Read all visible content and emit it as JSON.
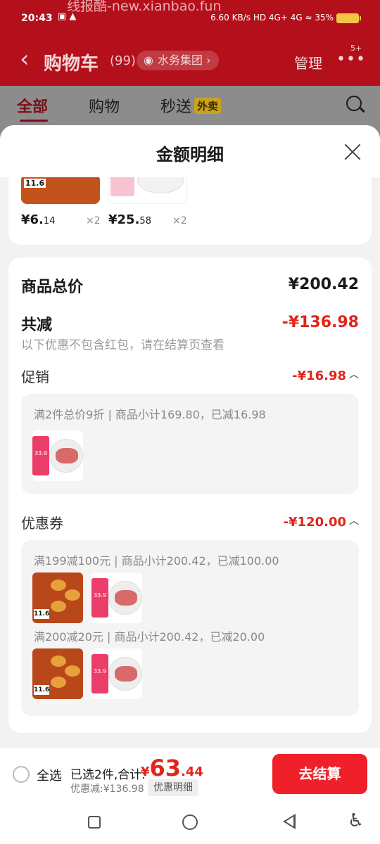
{
  "header": {
    "watermark": "线报酷-new.xianbao.fun",
    "status_time": "20:43",
    "status_left_icons": "▣ ▲",
    "status_right": "6.60 KB/s  HD  4G+ 4G  ≈ 35%",
    "title": "购物车",
    "count": "(99)",
    "org_label": "水务集团",
    "manage_label": "管理",
    "more_badge": "5+"
  },
  "tabs": [
    {
      "label": "全部"
    },
    {
      "label": "购物"
    },
    {
      "label": "秒送"
    }
  ],
  "tab_badge": "外卖",
  "sheet": {
    "title": "金额明细",
    "items": [
      {
        "price_int": "¥6.",
        "price_dec": "14",
        "qty": "×2",
        "thumb_label": "11.6"
      },
      {
        "price_int": "¥25.",
        "price_dec": "58",
        "qty": "×2",
        "thumb_label": "33.9"
      }
    ],
    "total_label": "商品总价",
    "total_value": "¥200.42",
    "reduce_label": "共减",
    "reduce_value": "-¥136.98",
    "reduce_note": "以下优惠不包含红包，请在结算页查看",
    "promo": {
      "label": "促销",
      "value": "-¥16.98",
      "rules": [
        {
          "text": "满2件总价9折 | 商品小计169.80，已减16.98"
        }
      ]
    },
    "coupon": {
      "label": "优惠券",
      "value": "-¥120.00",
      "rules": [
        {
          "text": "满199减100元 | 商品小计200.42，已减100.00"
        },
        {
          "text": "满200减20元 | 商品小计200.42，已减20.00"
        }
      ]
    },
    "thumb_food_tag": "11.6",
    "thumb_meat_tag": "33.9"
  },
  "bottom": {
    "select_all": "全选",
    "selected_text": "已选2件,合计:",
    "price_cur": "¥",
    "price_int": "63",
    "price_dec": ".44",
    "discount_text": "优惠减:¥136.98",
    "detail_btn": "优惠明细",
    "checkout": "去结算"
  },
  "colors": {
    "brand_red": "#e1251b",
    "checkout_red": "#f0202a",
    "header_red": "#b3101c"
  }
}
